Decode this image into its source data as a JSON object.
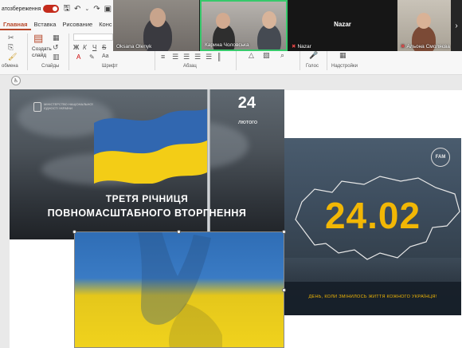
{
  "qat": {
    "autosave_label": "атозбереження"
  },
  "ribbon": {
    "tabs": [
      "Главная",
      "Вставка",
      "Рисование",
      "Конс"
    ],
    "groups": {
      "clipboard": "обмена",
      "slides": "Слайды",
      "font": "Шрифт",
      "paragraph": "Абзац",
      "voice": "Голос",
      "addins": "Надстройки"
    },
    "buttons": {
      "new_slide": "Создать слайд"
    }
  },
  "meeting": {
    "participants": [
      {
        "name": "Oksana Olenyk"
      },
      {
        "name": "Карина Чоловська"
      },
      {
        "name": "Nazar",
        "muted": true
      },
      {
        "name": "Альона Смоляєва",
        "muted": true
      }
    ],
    "video_off_name": "Nazar"
  },
  "slide": {
    "image1": {
      "ministry": "Міністерство національної єдності України",
      "date_number": "24",
      "date_month": "лютого",
      "title_line1": "ТРЕТЯ РІЧНИЦЯ",
      "title_line2": "ПОВНОМАСШТАБНОГО ВТОРГНЕННЯ"
    },
    "image2": {
      "brand": "FAM",
      "date": "24.02",
      "motto": "День, коли змінилось життя кожного українця!"
    }
  },
  "colors": {
    "flag_blue": "#2f6db5",
    "flag_yellow": "#f2c811",
    "accent": "#b7472a",
    "date_yellow": "#f2b705"
  }
}
